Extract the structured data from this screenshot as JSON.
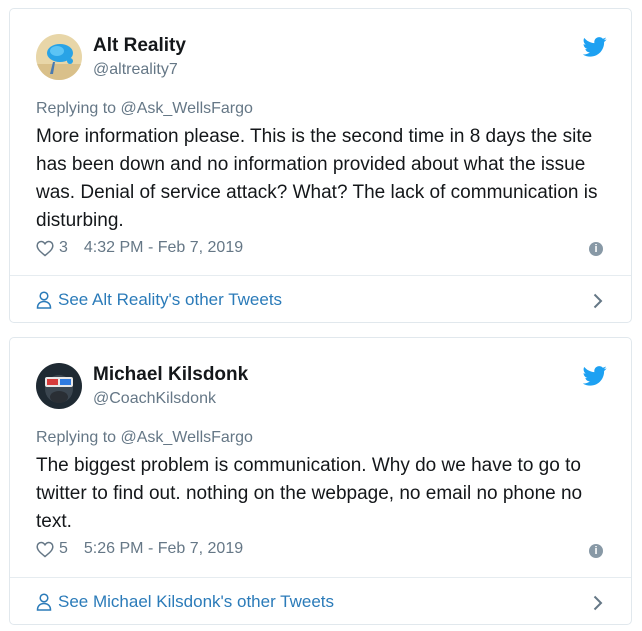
{
  "tweets": [
    {
      "name": "Alt Reality",
      "handle": "@altreality7",
      "replying_to": "Replying to @Ask_WellsFargo",
      "text": "More information please. This is the second time in 8 days the site has been down and no information provided about what the issue was. Denial of service attack? What? The lack of communication is disturbing.",
      "likes": "3",
      "timestamp": "4:32 PM - Feb 7, 2019",
      "more_link": "See Alt Reality's other Tweets",
      "avatar_icon": "blue-splash-avatar"
    },
    {
      "name": "Michael Kilsdonk",
      "handle": "@CoachKilsdonk",
      "replying_to": "Replying to @Ask_WellsFargo",
      "text": "The biggest problem is communication. Why do we have to go to twitter to find out. nothing on the webpage, no email no phone no text.",
      "likes": "5",
      "timestamp": "5:26 PM - Feb 7, 2019",
      "more_link": "See Michael Kilsdonk's other Tweets",
      "avatar_icon": "3d-glasses-avatar"
    }
  ],
  "colors": {
    "twitter_blue": "#1da1f2",
    "link_blue": "#2b7bb9",
    "muted_gray": "#657786",
    "border": "#e1e8ed"
  }
}
